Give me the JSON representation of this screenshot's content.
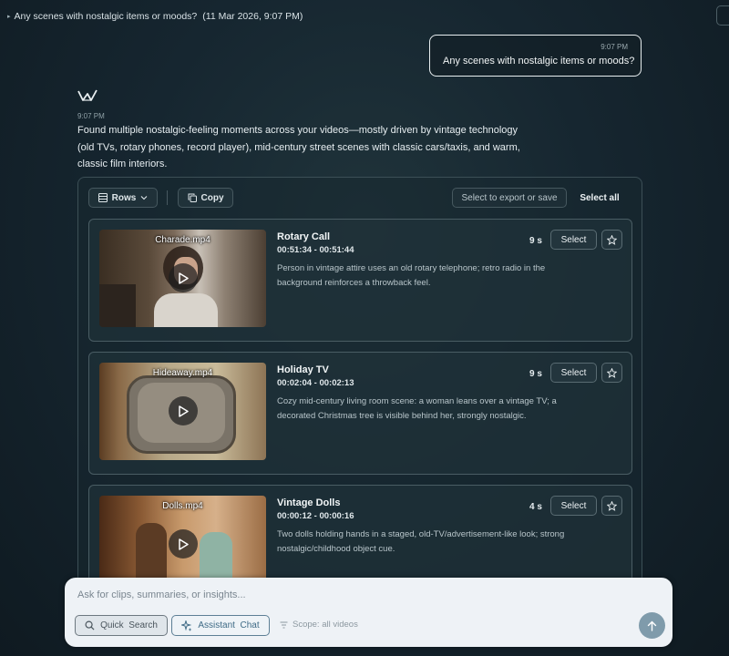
{
  "header": {
    "title": "Any scenes with nostalgic items or moods?",
    "date": "(11 Mar 2026, 9:07 PM)"
  },
  "user_message": {
    "time": "9:07 PM",
    "text": "Any scenes with nostalgic items or moods?"
  },
  "assistant": {
    "time": "9:07 PM",
    "text": "Found multiple nostalgic-feeling moments across your videos—mostly driven by vintage technology (old TVs, rotary phones, record player), mid-century street scenes with classic cars/taxis, and warm, classic film interiors."
  },
  "toolbar": {
    "rows_label": "Rows",
    "copy_label": "Copy",
    "export_label": "Select to export or save",
    "select_all_label": "Select all"
  },
  "results": [
    {
      "filename": "Charade.mp4",
      "title": "Rotary Call",
      "range": "00:51:34 - 00:51:44",
      "description": "Person in vintage attire uses an old rotary telephone; retro radio in the background reinforces a throwback feel.",
      "duration": "9 s",
      "select_label": "Select"
    },
    {
      "filename": "Hideaway.mp4",
      "title": "Holiday TV",
      "range": "00:02:04 - 00:02:13",
      "description": "Cozy mid-century living room scene: a woman leans over a vintage TV; a decorated Christmas tree is visible behind her, strongly nostalgic.",
      "duration": "9 s",
      "select_label": "Select"
    },
    {
      "filename": "Dolls.mp4",
      "title": "Vintage Dolls",
      "range": "00:00:12 - 00:00:16",
      "description": "Two dolls holding hands in a staged, old-TV/advertisement-like look; strong nostalgic/childhood object cue.",
      "duration": "4 s",
      "select_label": "Select"
    }
  ],
  "composer": {
    "placeholder": "Ask for clips, summaries, or insights...",
    "quick_search_label": "Quick  Search",
    "assistant_chat_label": "Assistant  Chat",
    "scope_label": "Scope: all videos"
  },
  "icons": {
    "rows": "rows-icon",
    "chevron": "chevron-down-icon",
    "copy": "copy-icon",
    "play": "play-icon",
    "star": "star-icon",
    "search": "search-icon",
    "sparkle": "sparkle-icon",
    "filter": "filter-icon",
    "send": "arrow-up-icon",
    "logo": "logo-icon"
  },
  "colors": {
    "background": "#162630",
    "composer": "#eef2f6",
    "accent": "#3f6b86",
    "send_button": "#7f9bab"
  }
}
